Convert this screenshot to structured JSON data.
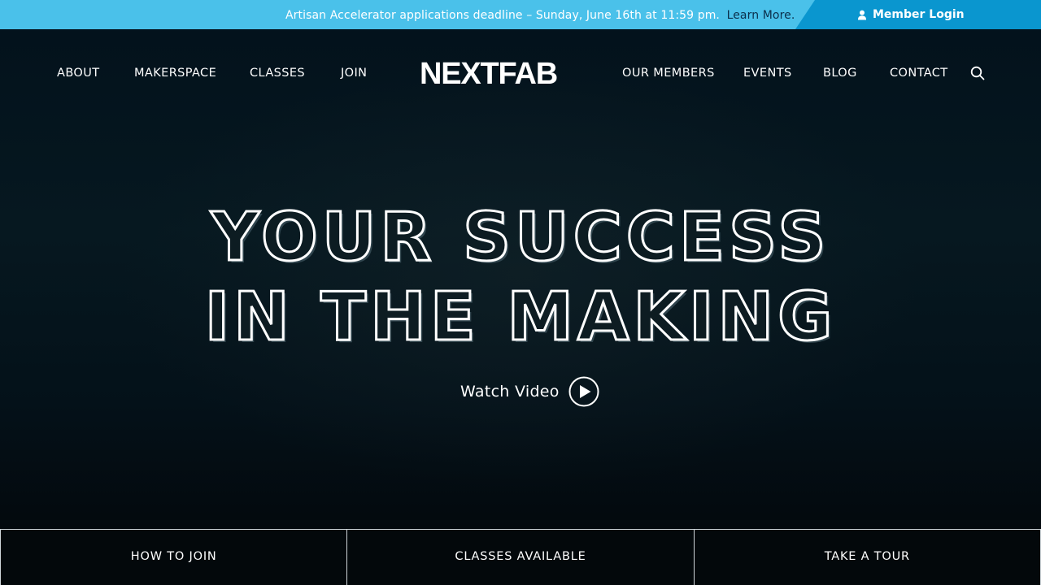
{
  "announcement": {
    "message": "Artisan Accelerator applications deadline – Sunday, June 16th at 11:59 pm.",
    "link_label": "Learn More."
  },
  "account": {
    "login_label": "Member Login",
    "icon": "user-icon"
  },
  "nav": {
    "left": [
      "ABOUT",
      "MAKERSPACE",
      "CLASSES",
      "JOIN"
    ],
    "logo": "NEXTFAB",
    "right": [
      "OUR MEMBERS",
      "EVENTS",
      "BLOG",
      "CONTACT"
    ],
    "search_icon": "search-icon"
  },
  "hero": {
    "headline_line1": "YOUR SUCCESS",
    "headline_line2": "IN THE MAKING",
    "watch_label": "Watch Video",
    "play_icon": "play-icon"
  },
  "cta": [
    "HOW TO JOIN",
    "CLASSES AVAILABLE",
    "TAKE A TOUR"
  ],
  "colors": {
    "topbar": "#4ac1ea",
    "login_bg": "#0a96cf",
    "link_dark": "#0b2f4b",
    "hero_bg": "#03121c"
  }
}
